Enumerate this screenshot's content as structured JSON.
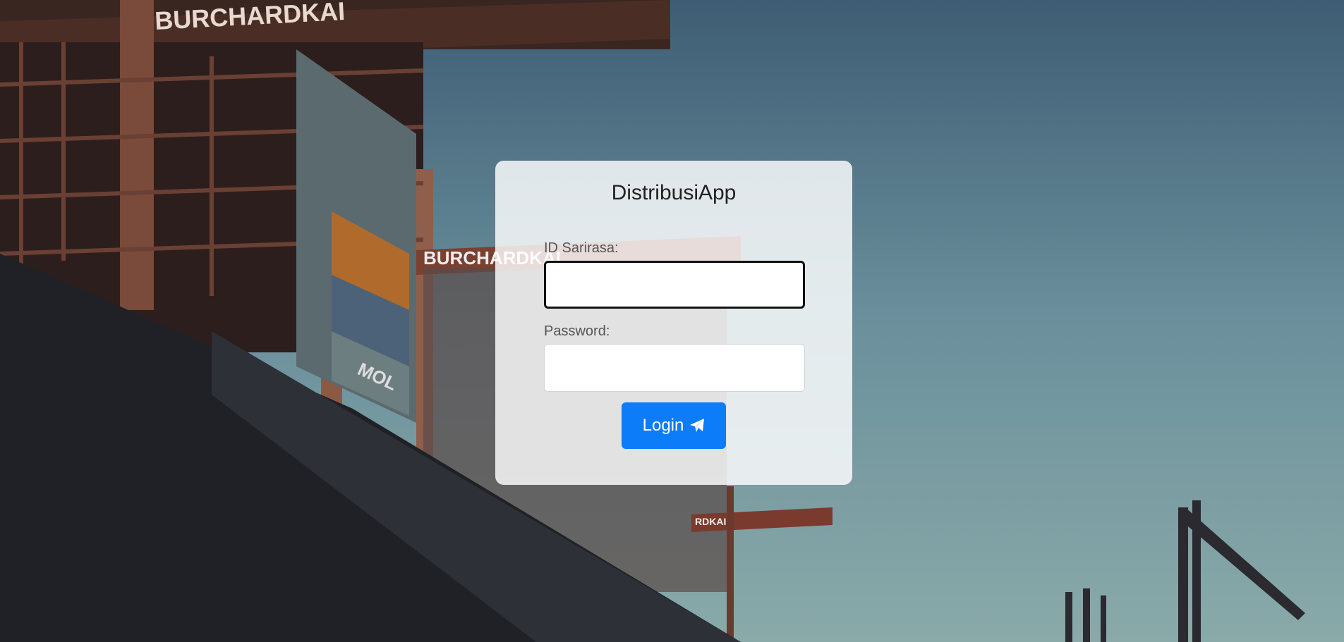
{
  "app": {
    "title": "DistribusiApp"
  },
  "form": {
    "id_label": "ID Sarirasa:",
    "id_value": "",
    "password_label": "Password:",
    "password_value": "",
    "login_label": "Login"
  },
  "icons": {
    "login_icon": "paper-plane-icon"
  },
  "colors": {
    "primary": "#0d7cf8",
    "card": "#ffffff"
  },
  "background": {
    "crane_signs": [
      "BURCHARDKAI",
      "BURCHARDKAI",
      "RDKAI"
    ],
    "container_marks": [
      "MOL"
    ]
  }
}
